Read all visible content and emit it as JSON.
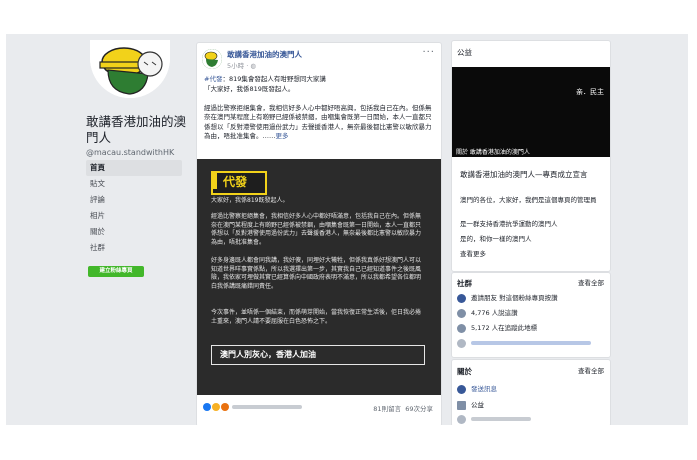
{
  "page": {
    "name": "敢講香港加油的澳門人",
    "handle": "@macau.standwithHK",
    "nav": [
      "首頁",
      "貼文",
      "評論",
      "相片",
      "關於",
      "社群"
    ],
    "create_page": "建立粉絲專頁"
  },
  "post": {
    "author": "敢講香港加油的澳門人",
    "time": "5小時",
    "more": "···",
    "tag": "#代發",
    "headline": "：819集會發起人有咁野想同大家講",
    "greeting": "「大家好，我係819既發起人。",
    "body": "經過比警察拒絕集會，我相信好多人心中都好唔高興，包括我自己在內。但係無奈在澳門某程度上有啲野已經係被禁錮，由嗰集會既第一日開始，本人一直都只係想以「反對港警使用過份武力」去聲援香港人，無奈最後都比憲警以敏欣暴力為由，唔批准集會。……",
    "see_more": "更多",
    "image": {
      "title": "代發",
      "lines": [
        "大家好，我係819既發起人。",
        "經過比警察拒絕集會，我相信好多人心中都好唔滿意，包括我自己在內。但係無奈在澳門某程度上有啲野已經係被禁錮，由嗰集會既第一日開始，本人一直都只係想以「反對港警使用過份武力」去聲援香港人，無奈最後都比憲警以敏欣暴力為由，唔批准集會。",
        "好多身邊既人都會同我講，我好傻，同埋好大犧牲，但係我真係好想澳門人可以知道世界咩事實係點，所以我選擇出第一步，其實我自己已經知道事件之後既風險，我依家可埋做其實已經算係向中國政府表明不滿意，所以我都希望各位都明白我係講既痛錯同責任。",
        "今次事件，並唔係一個結束，而係萌芽開始，當我恢復正常生活後，佢日我必捲土重來，澳門人請不要屈服在白色恐怖之下。"
      ],
      "footer": "澳門人別灰心，香港人加油"
    },
    "comments": "81則留言",
    "shares": "69次分享"
  },
  "right": {
    "public_label": "公益",
    "video_banner": "亲．民主",
    "video_caption": "關於 敢講香港加油的澳門人",
    "about_title": "敢講香港加油的澳門人—專頁成立宣言",
    "about_lines": [
      "澳門的各位，大家好，我們是這個專頁的管理員",
      "是一群支持香港抗爭運動的澳門人",
      "是的，和你一樣的澳門人"
    ],
    "see_more": "查看更多",
    "community": {
      "title": "社群",
      "see_all": "查看全部",
      "items": [
        "邀請朋友 對這個粉絲專頁按讚",
        "4,776 人說這讚",
        "5,172 人在追蹤此地標"
      ]
    },
    "about": {
      "title": "關於",
      "see_all": "查看全部",
      "items": [
        "發送訊息",
        "公益"
      ]
    }
  },
  "colors": {
    "link": "#385898",
    "accent_yellow": "#f2d21a",
    "green": "#42b72a"
  }
}
